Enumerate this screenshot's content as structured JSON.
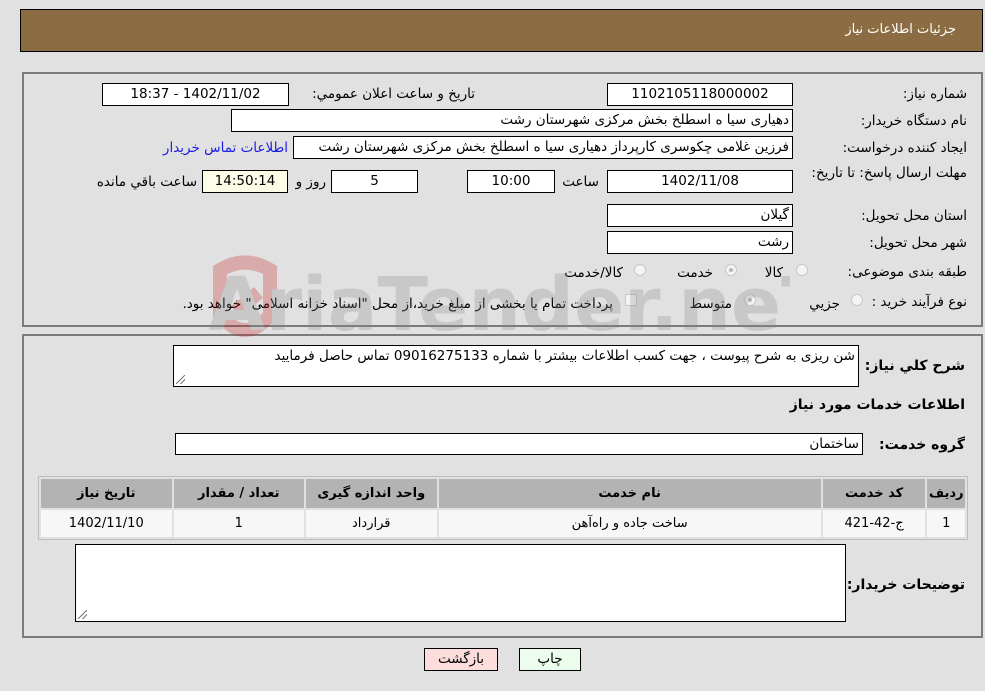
{
  "header": {
    "title": "جزئیات اطلاعات نیاز"
  },
  "form": {
    "need_number": {
      "label": "شماره نیاز:",
      "value": "1102105118000002"
    },
    "announce_datetime": {
      "label": "تاريخ و ساعت اعلان عمومي:",
      "value": "1402/11/02 - 18:37"
    },
    "buyer_org": {
      "label": "نام دستگاه خريدار:",
      "value": "دهیاری سیا ه اسطلخ بخش مرکزی شهرستان رشت"
    },
    "requester": {
      "label": "ايجاد کننده درخواست:",
      "value": "فرزین غلامی چکوسری کارپرداز دهیاری سیا ه اسطلخ بخش مرکزی شهرستان رشت",
      "contact_link": "اطلاعات تماس خريدار"
    },
    "deadline": {
      "label": "مهلت ارسال پاسخ: تا تاريخ:",
      "date": "1402/11/08",
      "time_label": "ساعت",
      "time": "10:00",
      "days": "5",
      "days_label": "روز و",
      "remaining": "14:50:14",
      "remaining_label": "ساعت باقي مانده"
    },
    "province": {
      "label": "استان محل تحويل:",
      "value": "گیلان"
    },
    "city": {
      "label": "شهر محل تحويل:",
      "value": "رشت"
    },
    "category": {
      "label": "طبقه بندی موضوعی:",
      "options": [
        "کالا",
        "خدمت",
        "کالا/خدمت"
      ],
      "selected": "خدمت"
    },
    "purchase_type": {
      "label": "نوع فرآيند خريد :",
      "options": [
        "جزيي",
        "متوسط"
      ],
      "selected": "متوسط",
      "treasury_note": "پرداخت تمام يا بخشی از مبلغ خريد،از محل \"اسناد خزانه اسلامی\" خواهد بود."
    }
  },
  "description": {
    "label": "شرح کلي نياز:",
    "value": "شن ریزی به شرح پیوست ، جهت کسب اطلاعات بیشتر با شماره  09016275133 تماس حاصل فرمایید"
  },
  "services": {
    "section_title": "اطلاعات خدمات مورد نياز",
    "group_label": "گروه خدمت:",
    "group_value": "ساختمان",
    "table": {
      "headers": [
        "رديف",
        "کد خدمت",
        "نام خدمت",
        "واحد اندازه گيری",
        "تعداد / مقدار",
        "تاريخ نياز"
      ],
      "rows": [
        [
          "1",
          "ج-42-421",
          "ساخت جاده و راه‌آهن",
          "قرارداد",
          "1",
          "1402/11/10"
        ]
      ]
    }
  },
  "buyer_notes": {
    "label": "توضيحات خريدار:",
    "value": ""
  },
  "buttons": {
    "print": "چاپ",
    "back": "بازگشت"
  },
  "watermark": {
    "text": "AriaTender.neT"
  }
}
